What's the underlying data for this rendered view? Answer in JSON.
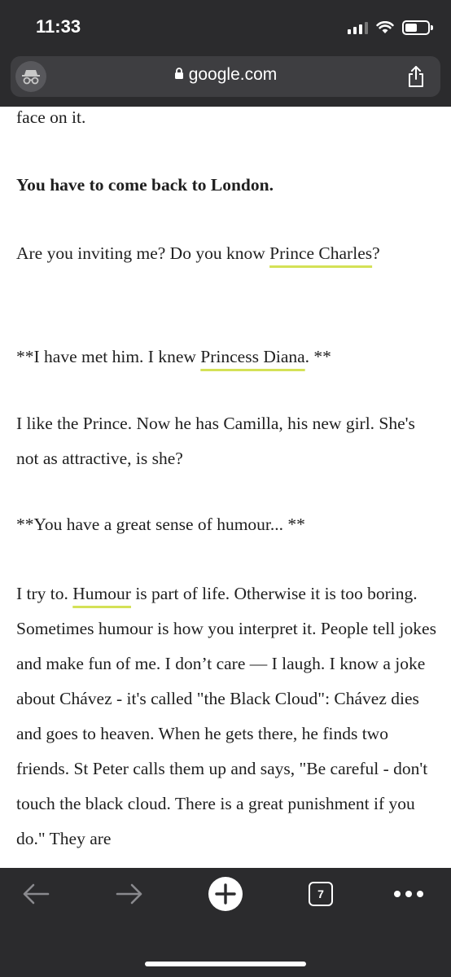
{
  "status_bar": {
    "time": "11:33"
  },
  "browser": {
    "url": "google.com"
  },
  "article": {
    "p1": "face on it.",
    "p2": "You have to come back to London.",
    "p3_before": "Are you inviting me? Do you know ",
    "p3_link": "Prince Charles",
    "p3_after": "?",
    "p4_before": "**I have met him. I knew ",
    "p4_link": "Princess Diana",
    "p4_after": ". **",
    "p5": "I like the Prince. Now he has Camilla, his new girl. She's not as attractive, is she?",
    "p6": "**You have a great sense of humour... **",
    "p7_before": "I try to. ",
    "p7_link": "Humour",
    "p7_after": " is part of life. Otherwise it is too boring. Sometimes humour is how you interpret it. People tell jokes and make fun of me. I don’t care — I laugh. I know a joke about Chávez - it's called \"the Black Cloud\": Chávez dies and goes to heaven. When he gets there, he finds two friends. St Peter calls them up and says, \"Be careful - don't touch the black cloud. There is a great punishment if you do.\" They are"
  },
  "toolbar": {
    "tab_count": "7"
  },
  "colors": {
    "chrome": "#2b2b2d",
    "url_bar": "#3e3e41",
    "link_underline": "#d4e157"
  }
}
